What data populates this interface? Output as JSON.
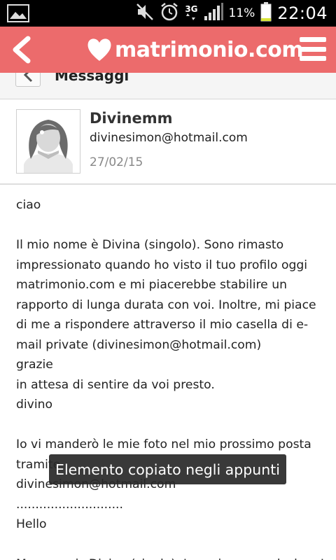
{
  "status_bar": {
    "network": "3G",
    "battery_percent": "11%",
    "time": "22:04"
  },
  "app_bar": {
    "brand": "matrimonio.com"
  },
  "section": {
    "title": "Messaggi"
  },
  "sender": {
    "name": "Divinemm",
    "email": "divinesimon@hotmail.com",
    "date": "27/02/15"
  },
  "message": {
    "p1": "ciao",
    "p2": "Il mio nome è Divina (singolo). Sono rimasto impressionato quando ho visto il tuo profilo oggi matrimonio.com e mi piacerebbe stabilire un rapporto di lunga durata con voi. Inoltre, mi piace di me a rispondere attraverso il mio casella di e-mail private (divinesimon@hotmail.com)\ngrazie\nin attesa di sentire da voi presto.\ndivino",
    "p3": "Io vi manderò le mie foto nel mio prossimo posta\ntramite\ndivinesimon@hotmail.com\n............................\nHello",
    "p4": "My name is Divina (single). I was impressed when I"
  },
  "toast": {
    "text": "Elemento copiato negli appunti"
  },
  "colors": {
    "appbar": "#ec6b6c",
    "statusbar": "#000000",
    "battery_low": "#d8e53a"
  }
}
